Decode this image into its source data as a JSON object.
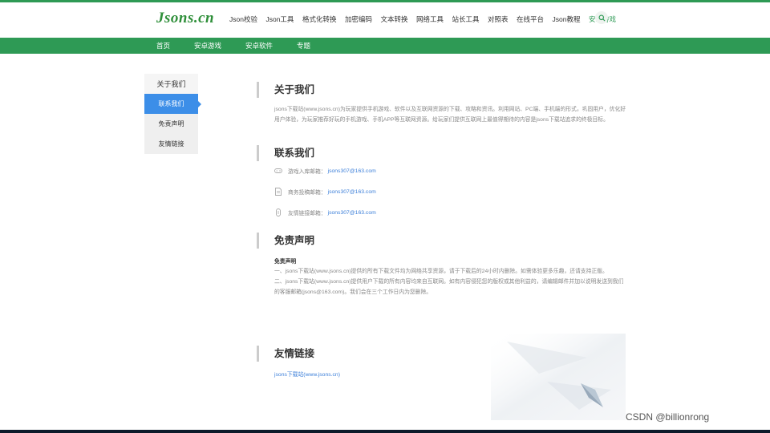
{
  "logo": {
    "text": "Jsons.cn"
  },
  "topnav": {
    "items": [
      {
        "label": "Json校验"
      },
      {
        "label": "Json工具"
      },
      {
        "label": "格式化转换"
      },
      {
        "label": "加密编码"
      },
      {
        "label": "文本转换"
      },
      {
        "label": "网络工具"
      },
      {
        "label": "站长工具"
      },
      {
        "label": "对照表"
      },
      {
        "label": "在线平台"
      },
      {
        "label": "Json教程"
      },
      {
        "label": "安卓游戏"
      }
    ],
    "active_index": 10
  },
  "subnav": {
    "items": [
      {
        "label": "首页"
      },
      {
        "label": "安卓游戏"
      },
      {
        "label": "安卓软件"
      },
      {
        "label": "专题"
      }
    ]
  },
  "sidebar": {
    "items": [
      {
        "label": "关于我们"
      },
      {
        "label": "联系我们"
      },
      {
        "label": "免责声明"
      },
      {
        "label": "友情链接"
      }
    ],
    "active_index": 1
  },
  "about": {
    "title": "关于我们",
    "text": "jsons下载站(www.jsons.cn)为玩家提供手机游戏、软件以及互联网资源的下载、攻略和资讯。利用网站、PC端、手机端的形式，巩固用户，优化好用户体验，为玩家推荐好玩的手机游戏、手机APP等互联网资源。给玩家们提供互联网上最值得期待的内容是jsons下载站追求的终极目标。"
  },
  "contact": {
    "title": "联系我们",
    "rows": [
      {
        "label": "游戏入库邮箱：",
        "email": "jsons307@163.com"
      },
      {
        "label": "商务投稿邮箱：",
        "email": "jsons307@163.com"
      },
      {
        "label": "友情链接邮箱：",
        "email": "jsons307@163.com"
      }
    ]
  },
  "disclaimer": {
    "title": "免责声明",
    "heading": "免责声明",
    "p1": "一、jsons下载站(www.jsons.cn)提供的所有下载文件均为网络共享资源，请于下载后的24小时内删除。如需体验更多乐趣，还请支持正版。",
    "p2": "二、jsons下载站(www.jsons.cn)提供用户下载的所有内容均来自互联网。如有内容侵犯您的版权或其他利益的，请编辑邮件并加以说明发送到我们的客服邮箱(jsons@163.com)。我们会在三个工作日内为您删除。"
  },
  "links": {
    "title": "友情链接",
    "items": [
      {
        "label": "jsons下载站(www.jsons.cn)"
      }
    ]
  },
  "watermark": {
    "text": "CSDN @billionrong"
  },
  "colors": {
    "brand_green": "#2e9a55",
    "active_blue": "#3c8ee8",
    "link_blue": "#3c7fd9"
  }
}
